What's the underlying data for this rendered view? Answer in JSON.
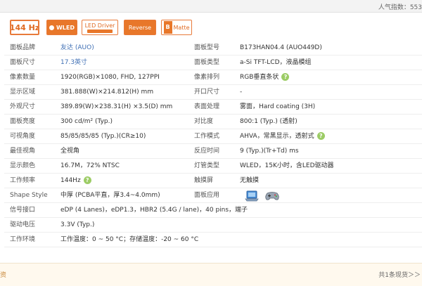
{
  "header": {
    "popularity": "人气指数：553"
  },
  "badges": {
    "refresh": "144 Hz",
    "wled": "WLED",
    "led_driver": "LED Driver",
    "reverse": "Reverse",
    "matte_letter": "B",
    "matte": "Matte"
  },
  "specs": [
    {
      "l1": "面板品牌",
      "v1": "友达 (AUO)",
      "l2": "面板型号",
      "v2": "B173HAN04.4 (AUO449D)"
    },
    {
      "l1": "面板尺寸",
      "v1": "17.3英寸",
      "l2": "面板类型",
      "v2": "a-Si TFT-LCD，液晶模组"
    },
    {
      "l1": "像素数量",
      "v1": "1920(RGB)×1080, FHD, 127PPI",
      "l2": "像素排列",
      "v2": "RGB垂直条状"
    },
    {
      "l1": "显示区域",
      "v1": "381.888(W)×214.812(H) mm",
      "l2": "开口尺寸",
      "v2": "-"
    },
    {
      "l1": "外观尺寸",
      "v1": "389.89(W)×238.31(H) ×3.5(D) mm",
      "l2": "表面处理",
      "v2": "雾面，Hard coating (3H)"
    },
    {
      "l1": "面板亮度",
      "v1": "300 cd/m² (Typ.)",
      "l2": "对比度",
      "v2": "800:1 (Typ.) (透射)"
    },
    {
      "l1": "可视角度",
      "v1": "85/85/85/85 (Typ.)(CR≥10)",
      "l2": "工作模式",
      "v2": "AHVA，常黑显示，透射式"
    },
    {
      "l1": "最佳视角",
      "v1": "全视角",
      "l2": "反应时间",
      "v2": "9 (Typ.)(Tr+Td) ms"
    },
    {
      "l1": "显示颜色",
      "v1": "16.7M，72% NTSC",
      "l2": "灯管类型",
      "v2": "WLED，15K小时，含LED驱动器"
    },
    {
      "l1": "工作频率",
      "v1": "144Hz",
      "l2": "触摸屏",
      "v2": "无触摸"
    },
    {
      "l1": "Shape Style",
      "v1": "中厚 (PCBA平直，厚3.4~4.0mm)",
      "l2": "面板应用",
      "v2": ""
    }
  ],
  "specs_long": [
    {
      "label": "信号接口",
      "value": "eDP (4 Lanes)，eDP1.3，HBR2 (5.4G / lane)，40 pins，端子"
    },
    {
      "label": "驱动电压",
      "value": "3.3V (Typ.)"
    },
    {
      "label": "工作环境",
      "value": "工作温度：0 ~ 50 °C；存储温度：-20 ~ 60 °C"
    }
  ],
  "footer": {
    "left": "资",
    "right": "共1条现货＞＞"
  },
  "icons": {
    "help": "help-icon",
    "laptop": "laptop-icon",
    "gamepad": "gamepad-icon"
  },
  "colors": {
    "accent": "#e8772a",
    "link": "#3f6fb4",
    "help": "#9ccc65"
  }
}
